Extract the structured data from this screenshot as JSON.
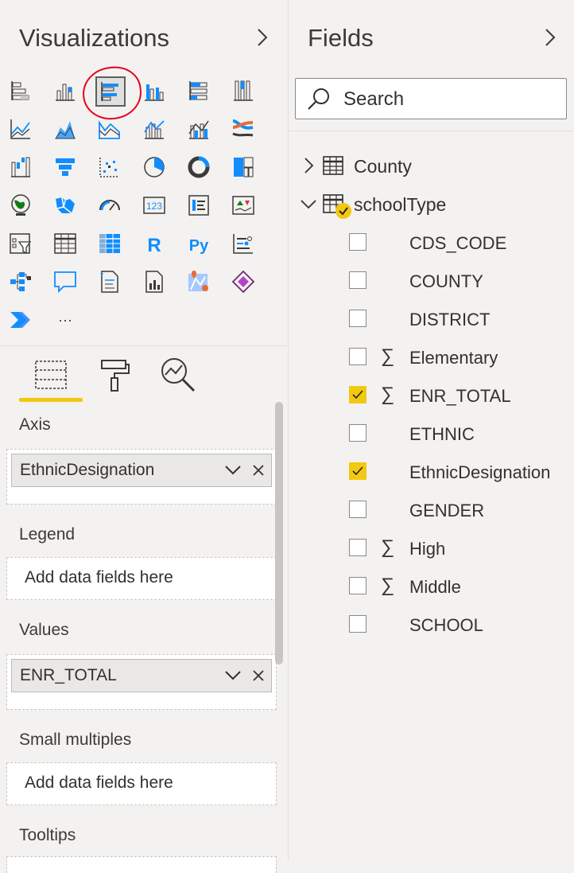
{
  "visualizations": {
    "title": "Visualizations",
    "icons": [
      "stacked-bar-chart-icon",
      "stacked-column-chart-icon",
      "clustered-bar-chart-icon",
      "clustered-column-chart-icon",
      "100-stacked-bar-chart-icon",
      "100-stacked-column-chart-icon",
      "line-chart-icon",
      "area-chart-icon",
      "stacked-area-chart-icon",
      "line-and-stacked-column-chart-icon",
      "line-and-clustered-column-chart-icon",
      "ribbon-chart-icon",
      "waterfall-chart-icon",
      "funnel-icon",
      "scatter-chart-icon",
      "pie-chart-icon",
      "donut-chart-icon",
      "treemap-icon",
      "map-icon",
      "filled-map-icon",
      "gauge-icon",
      "card-icon",
      "multi-row-card-icon",
      "kpi-icon",
      "slicer-icon",
      "table-icon",
      "matrix-icon",
      "r-script-visual-icon",
      "python-visual-icon",
      "key-influencers-icon",
      "decomposition-tree-icon",
      "qa-icon",
      "smart-narrative-icon",
      "paginated-report-icon",
      "arcgis-map-icon",
      "power-apps-icon",
      "power-automate-icon",
      "more-visuals-icon"
    ],
    "selected_icon": "clustered-bar-chart-icon",
    "card_text": "123",
    "r_label": "R",
    "py_label": "Py",
    "more_label": "···",
    "tabs": [
      "fields-tab-icon",
      "format-tab-icon",
      "analytics-tab-icon"
    ],
    "wells": {
      "axis": {
        "label": "Axis",
        "field": "EthnicDesignation"
      },
      "legend": {
        "label": "Legend",
        "placeholder": "Add data fields here"
      },
      "values": {
        "label": "Values",
        "field": "ENR_TOTAL"
      },
      "small_multiples": {
        "label": "Small multiples",
        "placeholder": "Add data fields here"
      },
      "tooltips": {
        "label": "Tooltips"
      }
    }
  },
  "fields": {
    "title": "Fields",
    "search_placeholder": "Search",
    "tables": [
      {
        "name": "County",
        "expanded": false
      },
      {
        "name": "schoolType",
        "expanded": true
      }
    ],
    "school_type_fields": [
      {
        "name": "CDS_CODE",
        "checked": false,
        "sigma": false
      },
      {
        "name": "COUNTY",
        "checked": false,
        "sigma": false
      },
      {
        "name": "DISTRICT",
        "checked": false,
        "sigma": false
      },
      {
        "name": "Elementary",
        "checked": false,
        "sigma": true
      },
      {
        "name": "ENR_TOTAL",
        "checked": true,
        "sigma": true
      },
      {
        "name": "ETHNIC",
        "checked": false,
        "sigma": false
      },
      {
        "name": "EthnicDesignation",
        "checked": true,
        "sigma": false
      },
      {
        "name": "GENDER",
        "checked": false,
        "sigma": false
      },
      {
        "name": "High",
        "checked": false,
        "sigma": true
      },
      {
        "name": "Middle",
        "checked": false,
        "sigma": true
      },
      {
        "name": "SCHOOL",
        "checked": false,
        "sigma": false
      }
    ],
    "sigma_symbol": "∑"
  },
  "colors": {
    "accent_yellow": "#f2c811",
    "icon_blue": "#118dff",
    "highlight_red": "#e8001c"
  }
}
